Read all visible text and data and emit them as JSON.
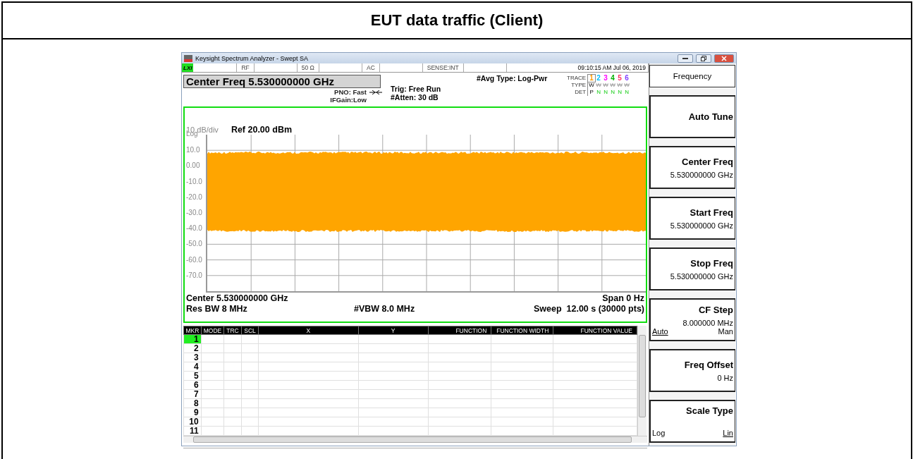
{
  "document": {
    "title": "EUT data traffic (Client)"
  },
  "window": {
    "title": "Keysight Spectrum Analyzer - Swept SA"
  },
  "status_bar": {
    "badge": "LXI",
    "fields": [
      "RF",
      "50 Ω",
      "AC",
      "SENSE:INT"
    ],
    "datetime": "09:10:15 AM Jul 06, 2019"
  },
  "header": {
    "center_freq": "Center Freq 5.530000000 GHz",
    "pno": "PNO: Fast",
    "ifgain": "IFGain:Low",
    "trig": "Trig: Free Run",
    "atten": "#Atten: 30 dB",
    "avg_type": "#Avg Type: Log-Pwr"
  },
  "trace_legend": {
    "trace_label": "TRACE",
    "type_label": "TYPE",
    "det_label": "DET",
    "traces": [
      {
        "number": "1",
        "color": "#ff9900",
        "selected": true,
        "type": "W",
        "det": "P",
        "active": true
      },
      {
        "number": "2",
        "color": "#00bfff",
        "selected": false,
        "type": "W",
        "det": "N",
        "active": false
      },
      {
        "number": "3",
        "color": "#ff00ff",
        "selected": false,
        "type": "W",
        "det": "N",
        "active": false
      },
      {
        "number": "4",
        "color": "#00b000",
        "selected": false,
        "type": "W",
        "det": "N",
        "active": false
      },
      {
        "number": "5",
        "color": "#ff3366",
        "selected": false,
        "type": "W",
        "det": "N",
        "active": false
      },
      {
        "number": "6",
        "color": "#8040ff",
        "selected": false,
        "type": "W",
        "det": "N",
        "active": false
      }
    ]
  },
  "graph": {
    "scale": "10 dB/div",
    "scale_type": "Log",
    "ref_level": "Ref 20.00 dBm",
    "y_labels": [
      "10.0",
      "0.00",
      "-10.0",
      "-20.0",
      "-30.0",
      "-40.0",
      "-50.0",
      "-60.0",
      "-70.0"
    ],
    "center": "Center 5.530000000 GHz",
    "span": "Span 0 Hz",
    "res_bw": "Res BW 8 MHz",
    "vbw": "#VBW 8.0 MHz",
    "sweep": "Sweep  12.00 s (30000 pts)"
  },
  "marker_table": {
    "columns": [
      "MKR",
      "MODE",
      "TRC",
      "SCL",
      "X",
      "Y",
      "FUNCTION",
      "FUNCTION WIDTH",
      "FUNCTION VALUE"
    ],
    "rows": [
      {
        "marker": "1",
        "selected": true
      },
      {
        "marker": "2",
        "selected": false
      },
      {
        "marker": "3",
        "selected": false
      },
      {
        "marker": "4",
        "selected": false
      },
      {
        "marker": "5",
        "selected": false
      },
      {
        "marker": "6",
        "selected": false
      },
      {
        "marker": "7",
        "selected": false
      },
      {
        "marker": "8",
        "selected": false
      },
      {
        "marker": "9",
        "selected": false
      },
      {
        "marker": "10",
        "selected": false
      },
      {
        "marker": "11",
        "selected": false
      }
    ]
  },
  "softkeys": [
    {
      "kind": "header",
      "label": "Frequency"
    },
    {
      "kind": "button",
      "label": "Auto Tune"
    },
    {
      "kind": "value",
      "label": "Center Freq",
      "value": "5.530000000 GHz"
    },
    {
      "kind": "value",
      "label": "Start Freq",
      "value": "5.530000000 GHz"
    },
    {
      "kind": "value",
      "label": "Stop Freq",
      "value": "5.530000000 GHz"
    },
    {
      "kind": "toggle",
      "label": "CF Step",
      "value": "8.000000 MHz",
      "options": [
        {
          "label": "Auto",
          "selected": true
        },
        {
          "label": "Man",
          "selected": false
        }
      ]
    },
    {
      "kind": "value",
      "label": "Freq Offset",
      "value": "0 Hz"
    },
    {
      "kind": "toggle",
      "label": "Scale Type",
      "options": [
        {
          "label": "Log",
          "selected": false
        },
        {
          "label": "Lin",
          "selected": true
        }
      ]
    }
  ]
}
